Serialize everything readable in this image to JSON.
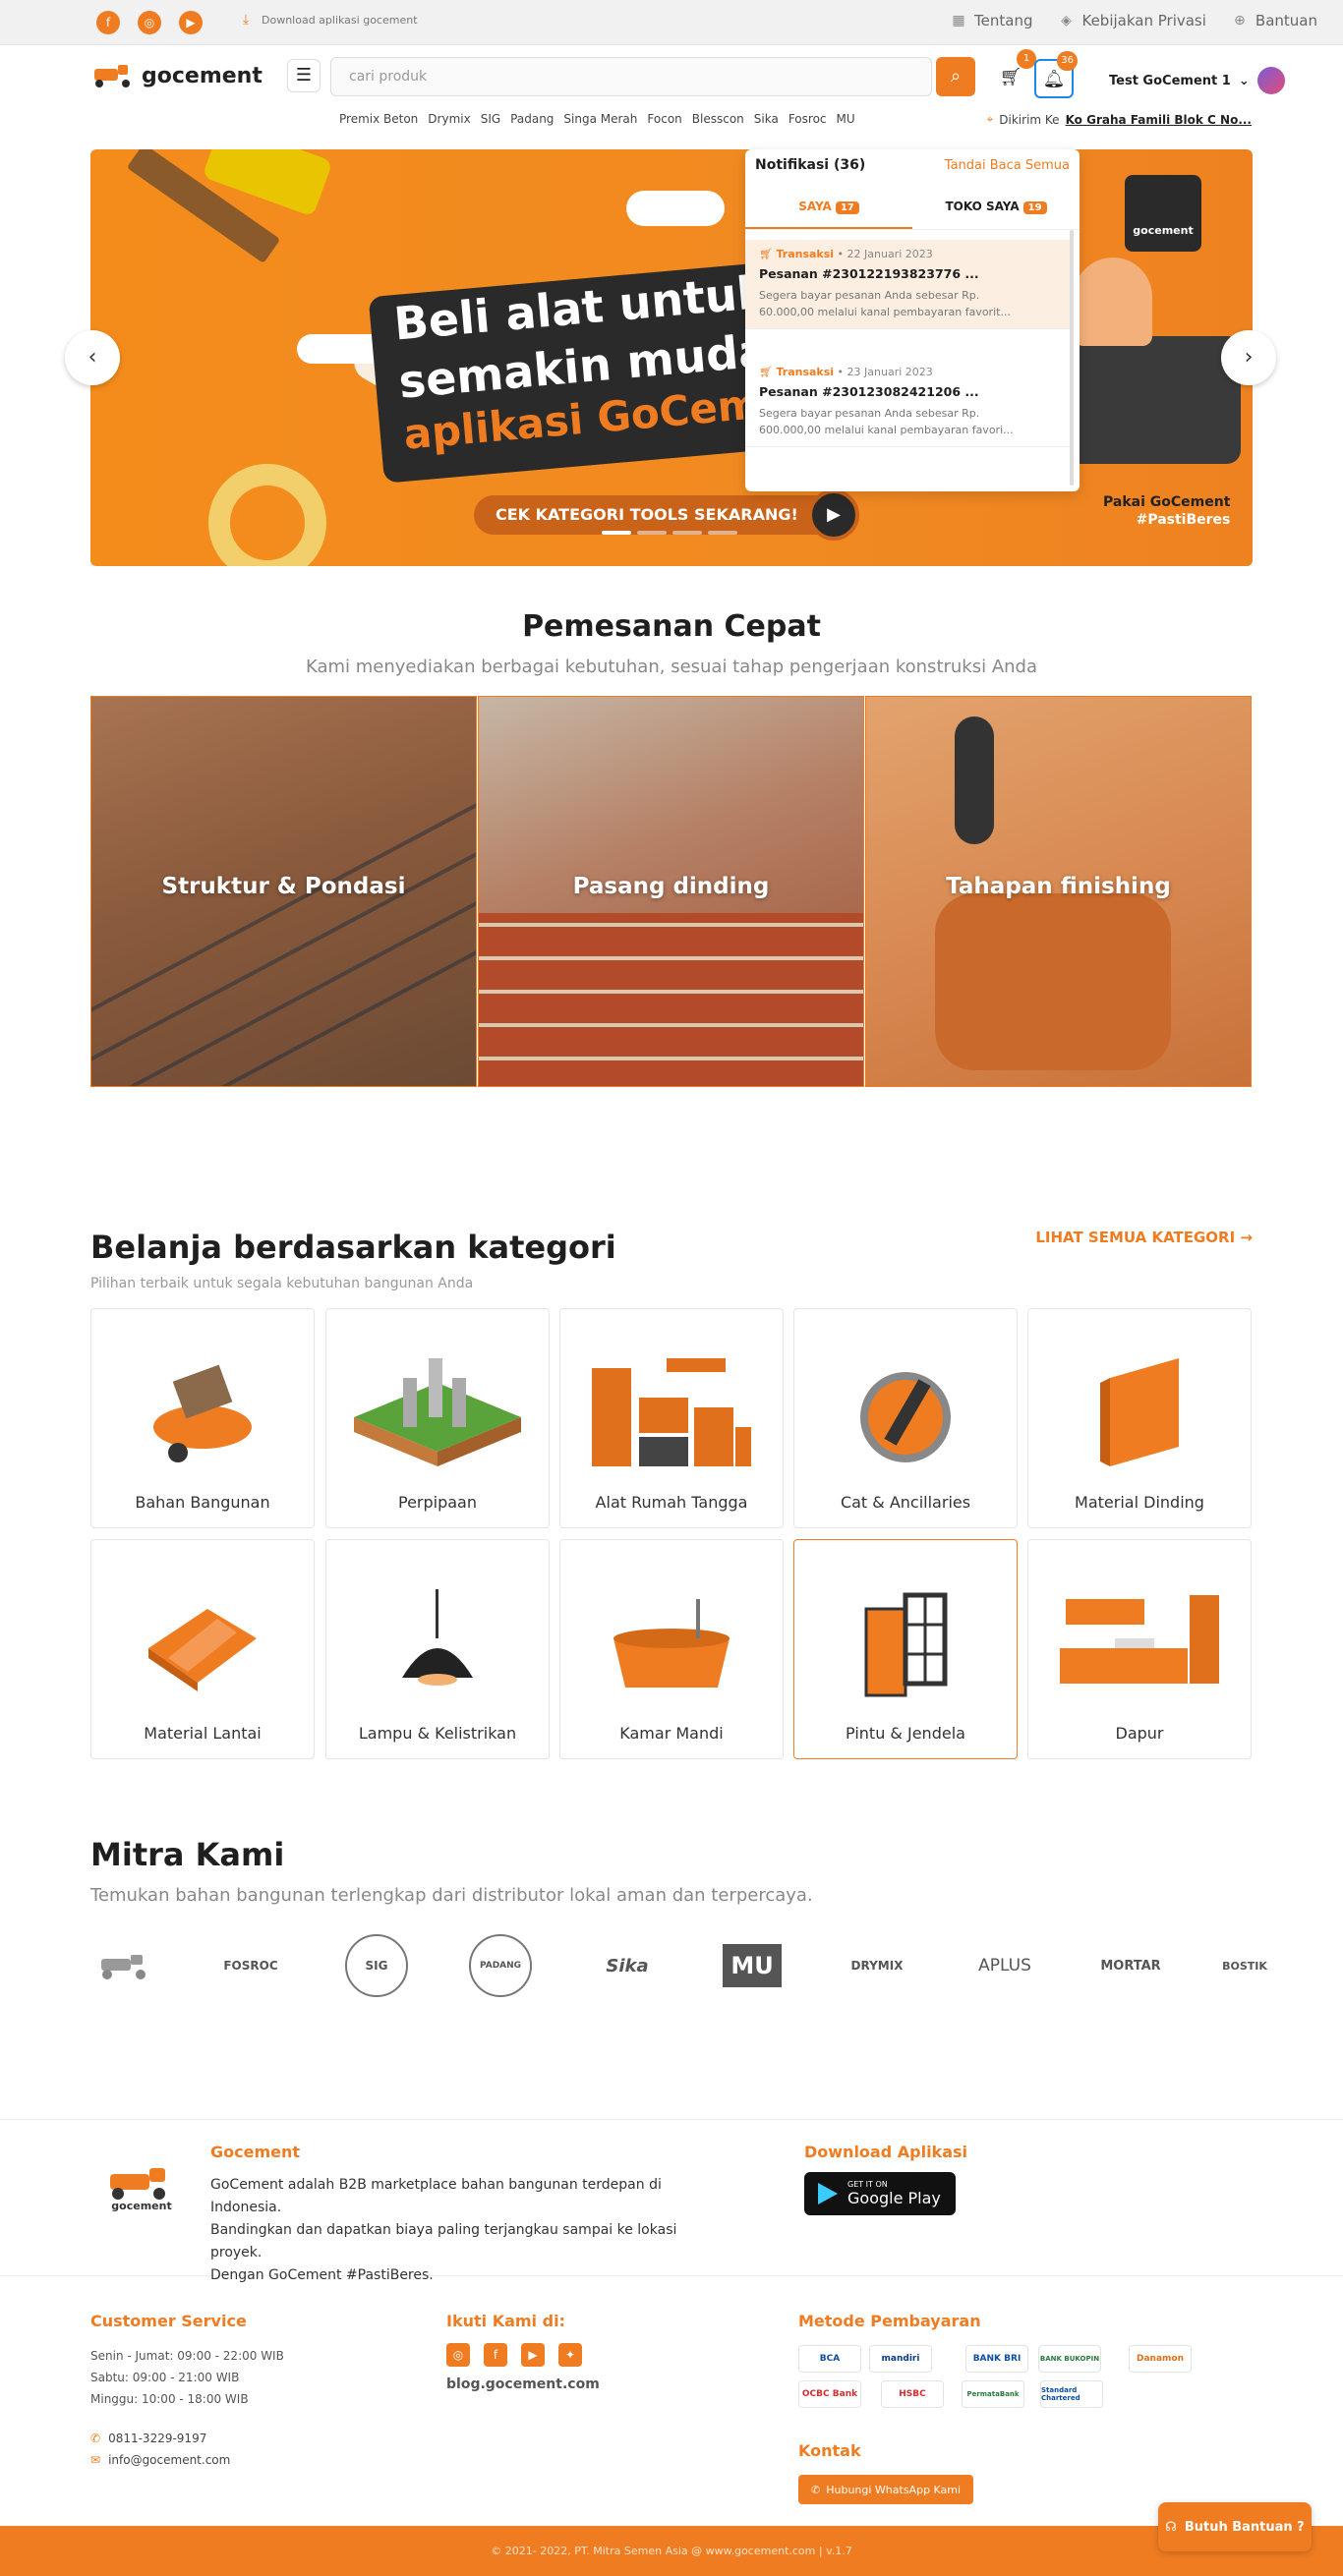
{
  "topbar": {
    "social": [
      "f",
      "◎",
      "▶"
    ],
    "download_label": "Download aplikasi gocement",
    "links": [
      "Tentang",
      "Kebijakan Privasi",
      "Bantuan"
    ]
  },
  "header": {
    "logo": "gocement",
    "search_placeholder": "cari produk",
    "cart_count": "1",
    "notif_count": "36",
    "user_name": "Test GoCement 1",
    "brands": [
      "Premix Beton",
      "Drymix",
      "SIG",
      "Padang",
      "Singa Merah",
      "Focon",
      "Blesscon",
      "Sika",
      "Fosroc",
      "MU"
    ],
    "ship_prefix": "Dikirim Ke",
    "ship_address": "Ko Graha Famili Blok C No..."
  },
  "banner": {
    "line1": "Beli alat untuk p",
    "line2": "semakin mudah",
    "line3": "aplikasi GoCem",
    "cta": "CEK KATEGORI TOOLS SEKARANG!",
    "tagline1": "Pakai GoCement",
    "tagline2": "#PastiBeres",
    "logo_text": "gocement"
  },
  "notifications": {
    "title": "Notifikasi (36)",
    "mark_all": "Tandai Baca Semua",
    "tabs": [
      {
        "label": "SAYA",
        "count": "17"
      },
      {
        "label": "TOKO SAYA",
        "count": "19"
      }
    ],
    "items": [
      {
        "type": "Transaksi",
        "date": "22 Januari 2023",
        "title": "Pesanan #230122193823776 ...",
        "desc1": "Segera bayar pesanan Anda sebesar Rp.",
        "desc2": "60.000,00 melalui kanal pembayaran favorit..."
      },
      {
        "type": "Transaksi",
        "date": "23 Januari 2023",
        "title": "Pesanan #230123082421206 ...",
        "desc1": "Segera bayar pesanan Anda sebesar Rp.",
        "desc2": "600.000,00 melalui kanal pembayaran favori..."
      }
    ]
  },
  "quick": {
    "title": "Pemesanan Cepat",
    "subtitle": "Kami menyediakan berbagai kebutuhan, sesuai tahap pengerjaan konstruksi Anda",
    "cards": [
      "Struktur & Pondasi",
      "Pasang dinding",
      "Tahapan finishing"
    ]
  },
  "categories": {
    "title": "Belanja berdasarkan kategori",
    "subtitle": "Pilihan terbaik untuk segala kebutuhan bangunan Anda",
    "see_all": "LIHAT SEMUA KATEGORI",
    "items": [
      "Bahan Bangunan",
      "Perpipaan",
      "Alat Rumah Tangga",
      "Cat & Ancillaries",
      "Material Dinding",
      "Material Lantai",
      "Lampu & Kelistrikan",
      "Kamar Mandi",
      "Pintu & Jendela",
      "Dapur"
    ]
  },
  "mitra": {
    "title": "Mitra Kami",
    "subtitle": "Temukan bahan bangunan terlengkap dari distributor lokal aman dan terpercaya.",
    "partners": [
      "",
      "FOSROC",
      "SIG",
      "PADANG",
      "Sika",
      "MU",
      "DRYMIX",
      "APLUS",
      "MORTAR",
      "BOSTIK"
    ]
  },
  "footer": {
    "about_title": "Gocement",
    "about_text1": "GoCement adalah B2B marketplace bahan bangunan terdepan di Indonesia.",
    "about_text2": "Bandingkan dan dapatkan biaya paling terjangkau sampai ke lokasi proyek.",
    "about_text3": "Dengan GoCement #PastiBeres.",
    "download_title": "Download Aplikasi",
    "gplay_small": "GET IT ON",
    "gplay_big": "Google Play",
    "cs_title": "Customer Service",
    "cs_hours": [
      "Senin - Jumat: 09:00 - 22:00 WIB",
      "Sabtu: 09:00 - 21:00 WIB",
      "Minggu: 10:00 - 18:00 WIB"
    ],
    "phone": "0811-3229-9197",
    "email": "info@gocement.com",
    "follow_title": "Ikuti Kami di:",
    "blog": "blog.gocement.com",
    "payment_title": "Metode Pembayaran",
    "payments": [
      "BCA",
      "mandiri",
      "BANK BRI",
      "BANK BUKOPIN",
      "Danamon",
      "OCBC Bank",
      "HSBC",
      "PermataBank",
      "Standard Chartered"
    ],
    "contact_title": "Kontak",
    "wa_label": "Hubungi WhatsApp Kami",
    "copyright": "© 2021- 2022, PT. Mitra Semen Asia @ www.gocement.com | v.1.7",
    "help": "Butuh Bantuan ?"
  },
  "colors": {
    "accent": "#f07c22",
    "dark": "#2a2a2a"
  }
}
